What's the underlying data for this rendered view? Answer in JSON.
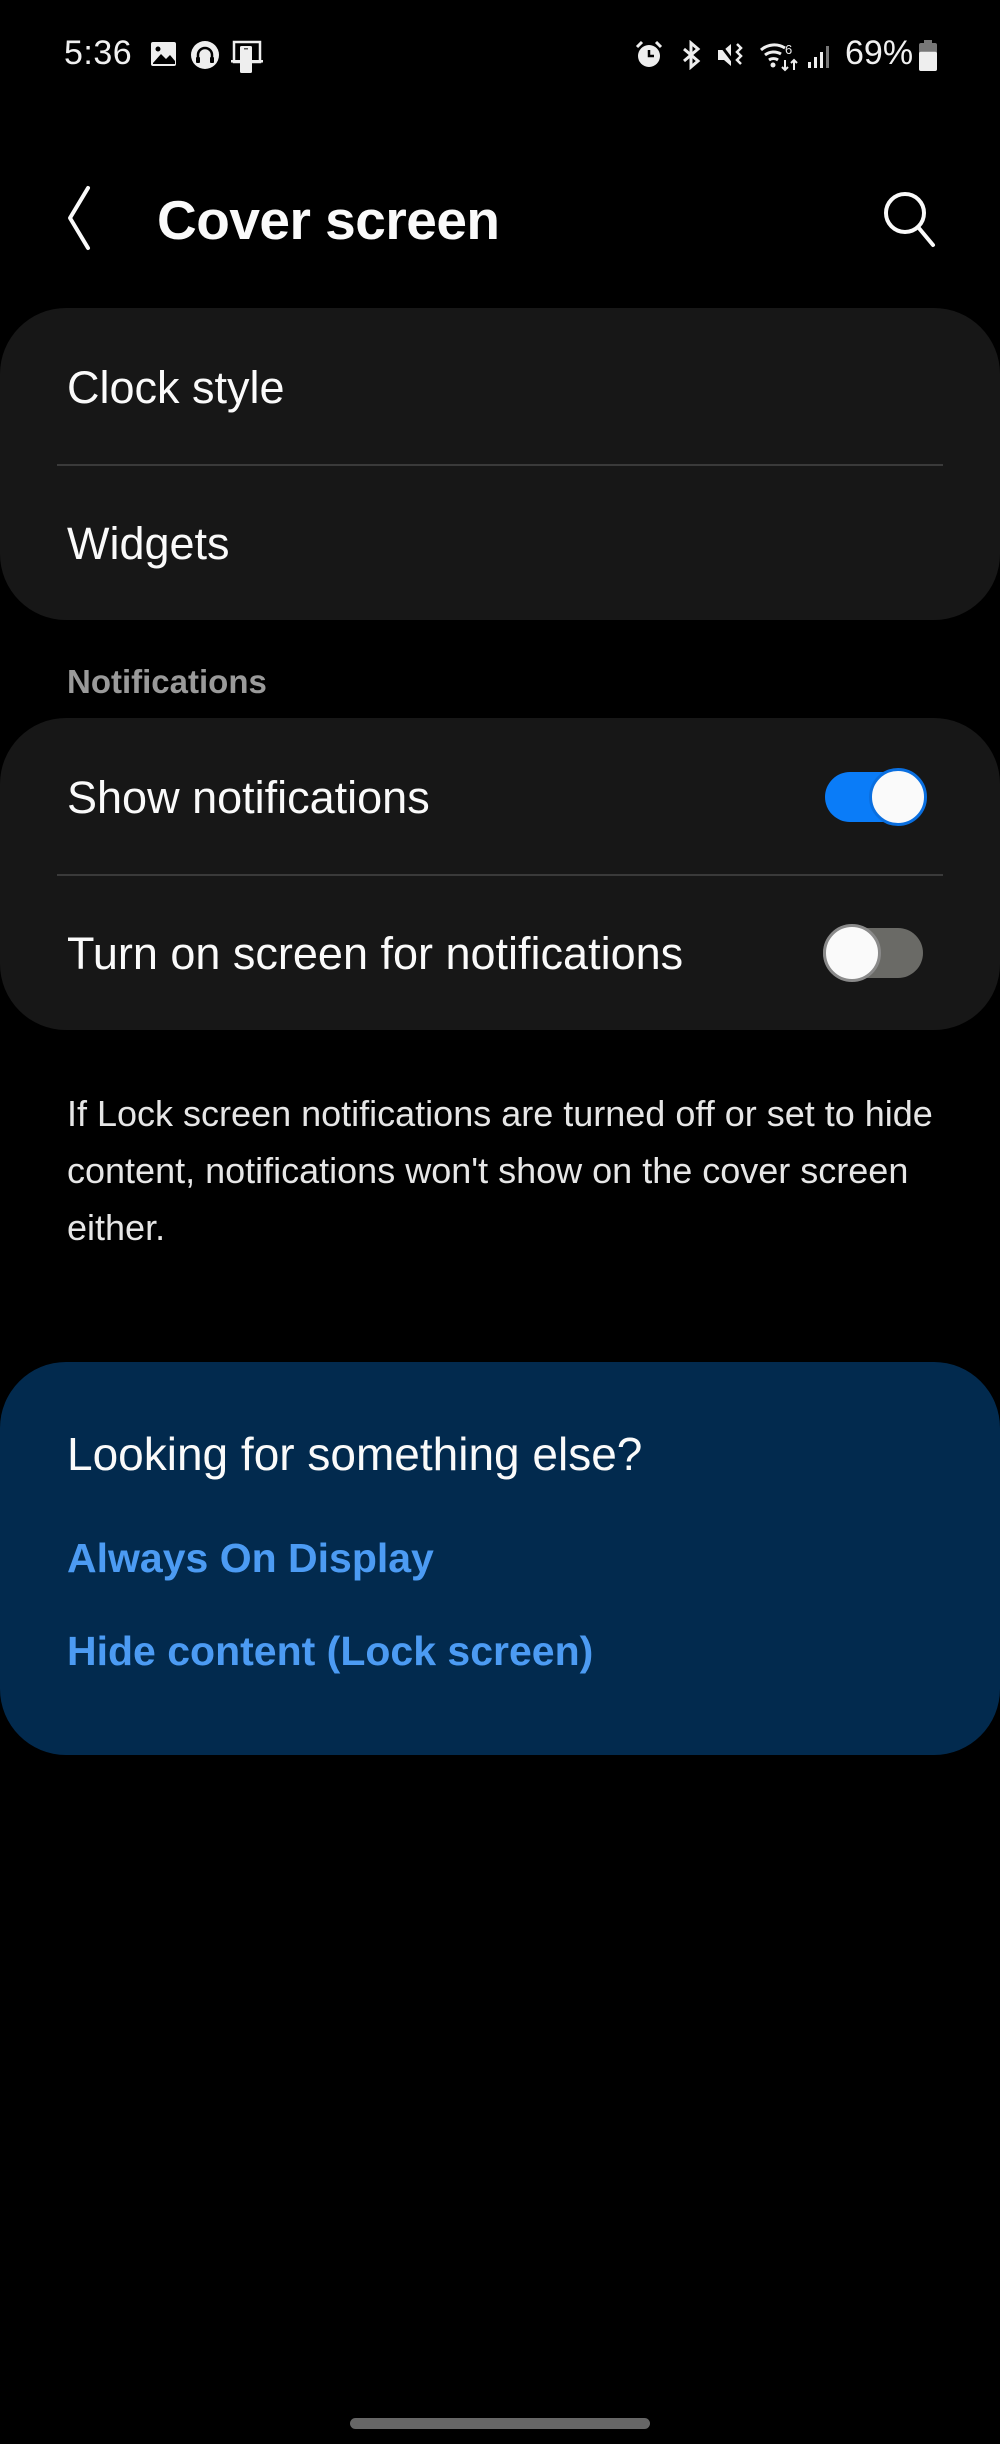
{
  "status_bar": {
    "time": "5:36",
    "left_icons": [
      "gallery-icon",
      "podcast-icon",
      "flex-mode-phone-icon"
    ],
    "right_icons": [
      "alarm-icon",
      "bluetooth-icon",
      "mute-vibrate-icon",
      "wifi-6-icon",
      "signal-icon",
      "battery-icon"
    ],
    "battery_percent": "69%",
    "battery_level": 0.69
  },
  "header": {
    "title": "Cover screen",
    "back_icon": "chevron-left-icon",
    "search_icon": "search-icon"
  },
  "group1": {
    "items": [
      {
        "label": "Clock style"
      },
      {
        "label": "Widgets"
      }
    ]
  },
  "notifications": {
    "section_title": "Notifications",
    "items": [
      {
        "label": "Show notifications",
        "enabled": true
      },
      {
        "label": "Turn on screen for notifications",
        "enabled": false
      }
    ],
    "info": "If Lock screen notifications are turned off or set to hide content, notifications won't show on the cover screen either."
  },
  "suggestions": {
    "title": "Looking for something else?",
    "links": [
      {
        "label": "Always On Display"
      },
      {
        "label": "Hide content (Lock screen)"
      }
    ]
  },
  "colors": {
    "background": "#000000",
    "card": "#171717",
    "accent": "#0a7cf8",
    "link": "#4c9bf3",
    "suggest_card": "#022a4e"
  }
}
